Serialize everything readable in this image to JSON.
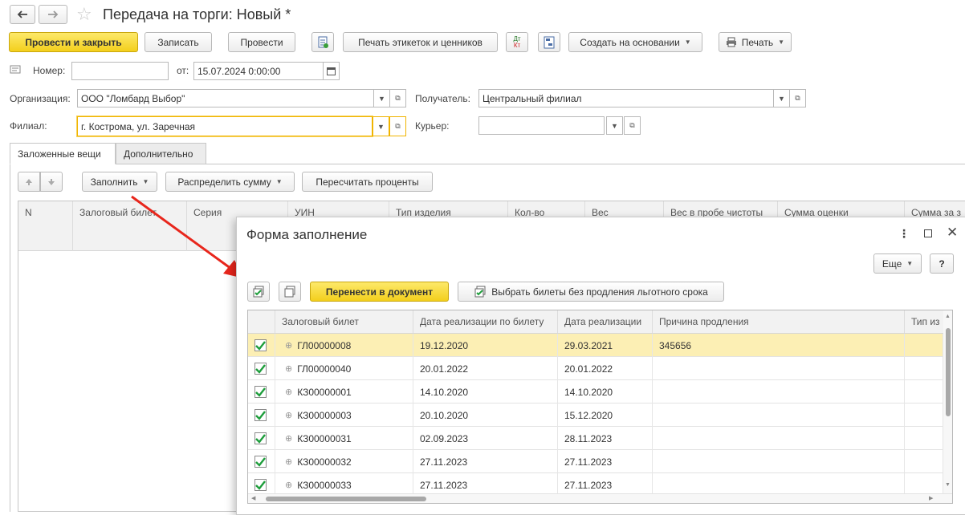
{
  "window": {
    "title": "Передача на торги: Новый *"
  },
  "toolbar": {
    "post_close": "Провести и закрыть",
    "save": "Записать",
    "post": "Провести",
    "print_labels": "Печать этикеток и ценников",
    "create_based_on": "Создать на основании",
    "print": "Печать",
    "dt_kt_top": "Дт",
    "dt_kt_bottom": "Кт"
  },
  "form": {
    "number_label": "Номер:",
    "number_value": "",
    "date_label": "от:",
    "date_value": "15.07.2024  0:00:00",
    "org_label": "Организация:",
    "org_value": "ООО \"Ломбард Выбор\"",
    "recipient_label": "Получатель:",
    "recipient_value": "Центральный филиал",
    "branch_label": "Филиал:",
    "branch_value": "г. Кострома, ул. Заречная",
    "courier_label": "Курьер:",
    "courier_value": ""
  },
  "tabs": [
    {
      "label": "Заложенные вещи",
      "active": true
    },
    {
      "label": "Дополнительно",
      "active": false
    }
  ],
  "table_toolbar": {
    "fill": "Заполнить",
    "distribute": "Распределить сумму",
    "recalc": "Пересчитать проценты"
  },
  "main_table": {
    "columns": [
      "N",
      "Залоговый билет",
      "Серия",
      "УИН",
      "Тип изделия",
      "Кол-во",
      "Вес",
      "Вес в пробе чистоты",
      "Сумма оценки",
      "Сумма за з"
    ]
  },
  "modal": {
    "title": "Форма заполнение",
    "more": "Еще",
    "help": "?",
    "transfer": "Перенести в документ",
    "select_tickets": "Выбрать билеты без продления льготного срока",
    "columns": [
      "Залоговый билет",
      "Дата реализации по билету",
      "Дата реализации",
      "Причина продления",
      "Тип из"
    ],
    "rows": [
      {
        "checked": true,
        "ticket": "ГЛ00000008",
        "date_ticket": "19.12.2020",
        "date_real": "29.03.2021",
        "reason": "345656",
        "selected": true
      },
      {
        "checked": true,
        "ticket": "ГЛ00000040",
        "date_ticket": "20.01.2022",
        "date_real": "20.01.2022",
        "reason": "",
        "selected": false
      },
      {
        "checked": true,
        "ticket": "КЗ00000001",
        "date_ticket": "14.10.2020",
        "date_real": "14.10.2020",
        "reason": "",
        "selected": false
      },
      {
        "checked": true,
        "ticket": "КЗ00000003",
        "date_ticket": "20.10.2020",
        "date_real": "15.12.2020",
        "reason": "",
        "selected": false
      },
      {
        "checked": true,
        "ticket": "КЗ00000031",
        "date_ticket": "02.09.2023",
        "date_real": "28.11.2023",
        "reason": "",
        "selected": false
      },
      {
        "checked": true,
        "ticket": "КЗ00000032",
        "date_ticket": "27.11.2023",
        "date_real": "27.11.2023",
        "reason": "",
        "selected": false
      },
      {
        "checked": true,
        "ticket": "КЗ00000033",
        "date_ticket": "27.11.2023",
        "date_real": "27.11.2023",
        "reason": "",
        "selected": false
      }
    ]
  },
  "colors": {
    "accent_yellow": "#f3cf1c",
    "selected_row": "#fcefb4",
    "arrow": "#e8261c",
    "check": "#1e9e3c"
  }
}
